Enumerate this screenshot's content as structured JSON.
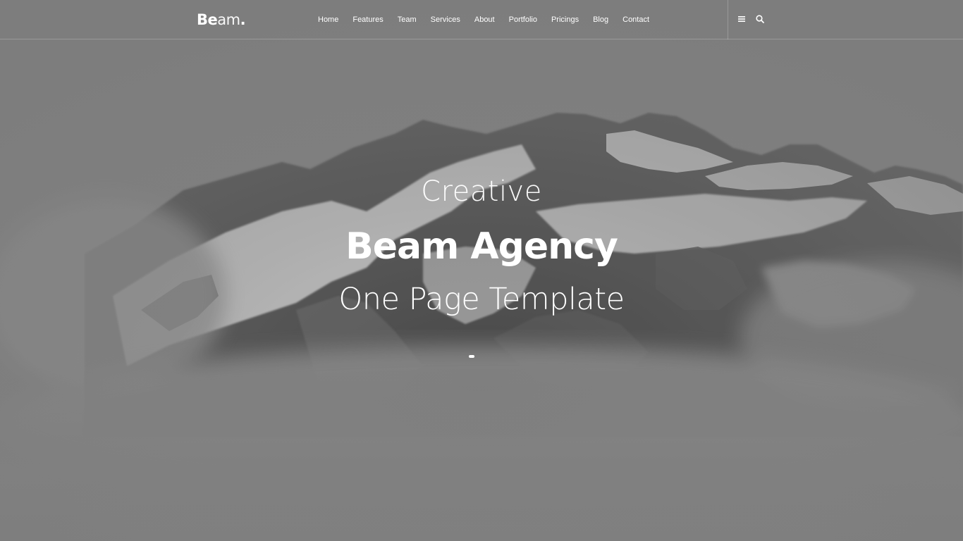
{
  "brand": {
    "logo_strong": "Be",
    "logo_light": "am",
    "logo_dot": "."
  },
  "nav": {
    "items": [
      {
        "label": "Home"
      },
      {
        "label": "Features"
      },
      {
        "label": "Team"
      },
      {
        "label": "Services"
      },
      {
        "label": "About"
      },
      {
        "label": "Portfolio"
      },
      {
        "label": "Pricings"
      },
      {
        "label": "Blog"
      },
      {
        "label": "Contact"
      }
    ],
    "tools": [
      {
        "icon": "menu-icon"
      },
      {
        "icon": "search-icon"
      }
    ]
  },
  "hero": {
    "line1": "Creative",
    "line2": "Beam Agency",
    "line3": "One Page Template"
  },
  "colors": {
    "overlay": "#7d7d7d",
    "text": "#ffffff"
  }
}
